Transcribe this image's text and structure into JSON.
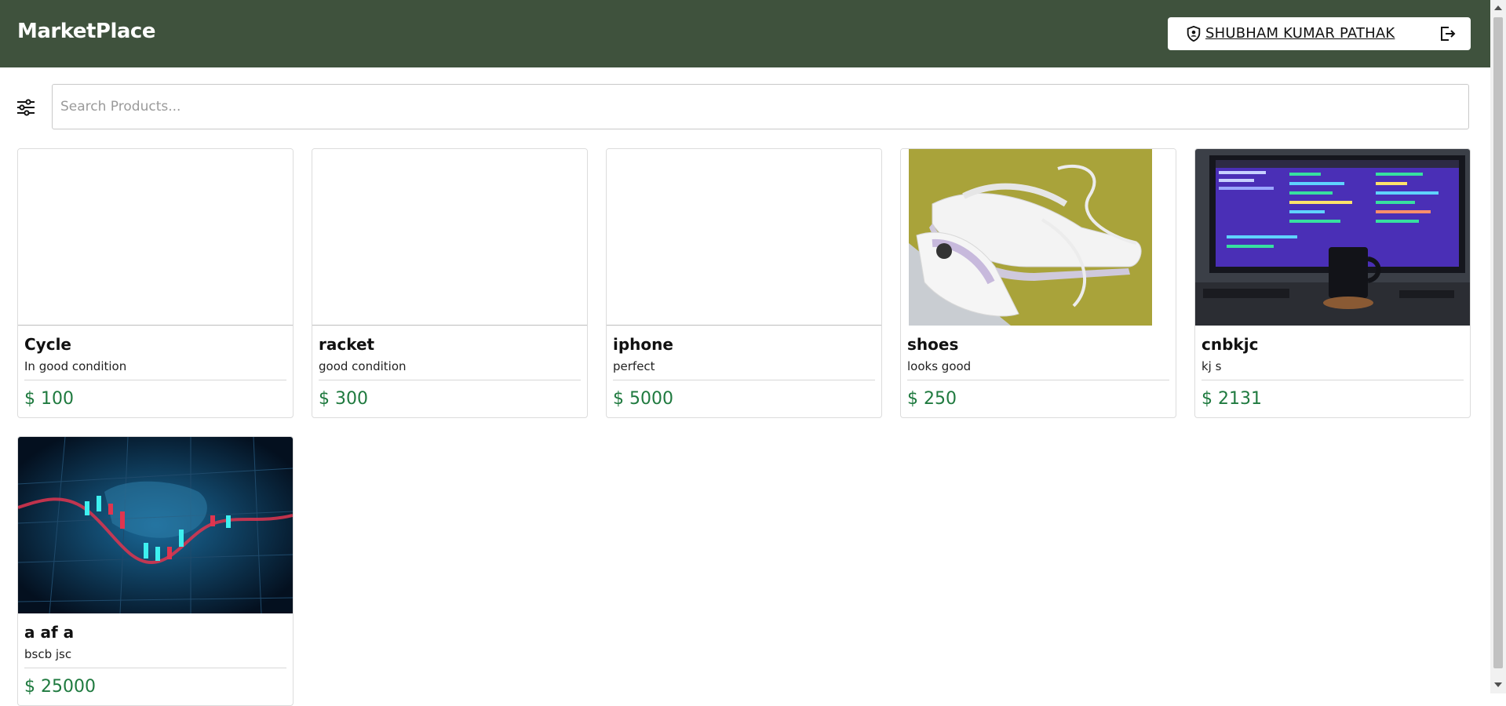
{
  "header": {
    "brand": "MarketPlace",
    "user_name": "SHUBHAM KUMAR PATHAK",
    "background": "#3f523d"
  },
  "search": {
    "placeholder": "Search Products..."
  },
  "products": [
    {
      "title": "Cycle",
      "desc": "In good condition",
      "price": "$ 100",
      "image": "none"
    },
    {
      "title": "racket",
      "desc": "good condition",
      "price": "$ 300",
      "image": "none"
    },
    {
      "title": "iphone",
      "desc": "perfect",
      "price": "$ 5000",
      "image": "none"
    },
    {
      "title": "shoes",
      "desc": "looks good",
      "price": "$ 250",
      "image": "white-sneakers-photo"
    },
    {
      "title": "cnbkjc",
      "desc": "kj s",
      "price": "$ 2131",
      "image": "code-monitor-photo"
    },
    {
      "title": "a af a",
      "desc": "bscb jsc",
      "price": "$ 25000",
      "image": "stock-chart-photo"
    }
  ],
  "colors": {
    "price": "#1f7a3f",
    "header": "#3f523d"
  }
}
